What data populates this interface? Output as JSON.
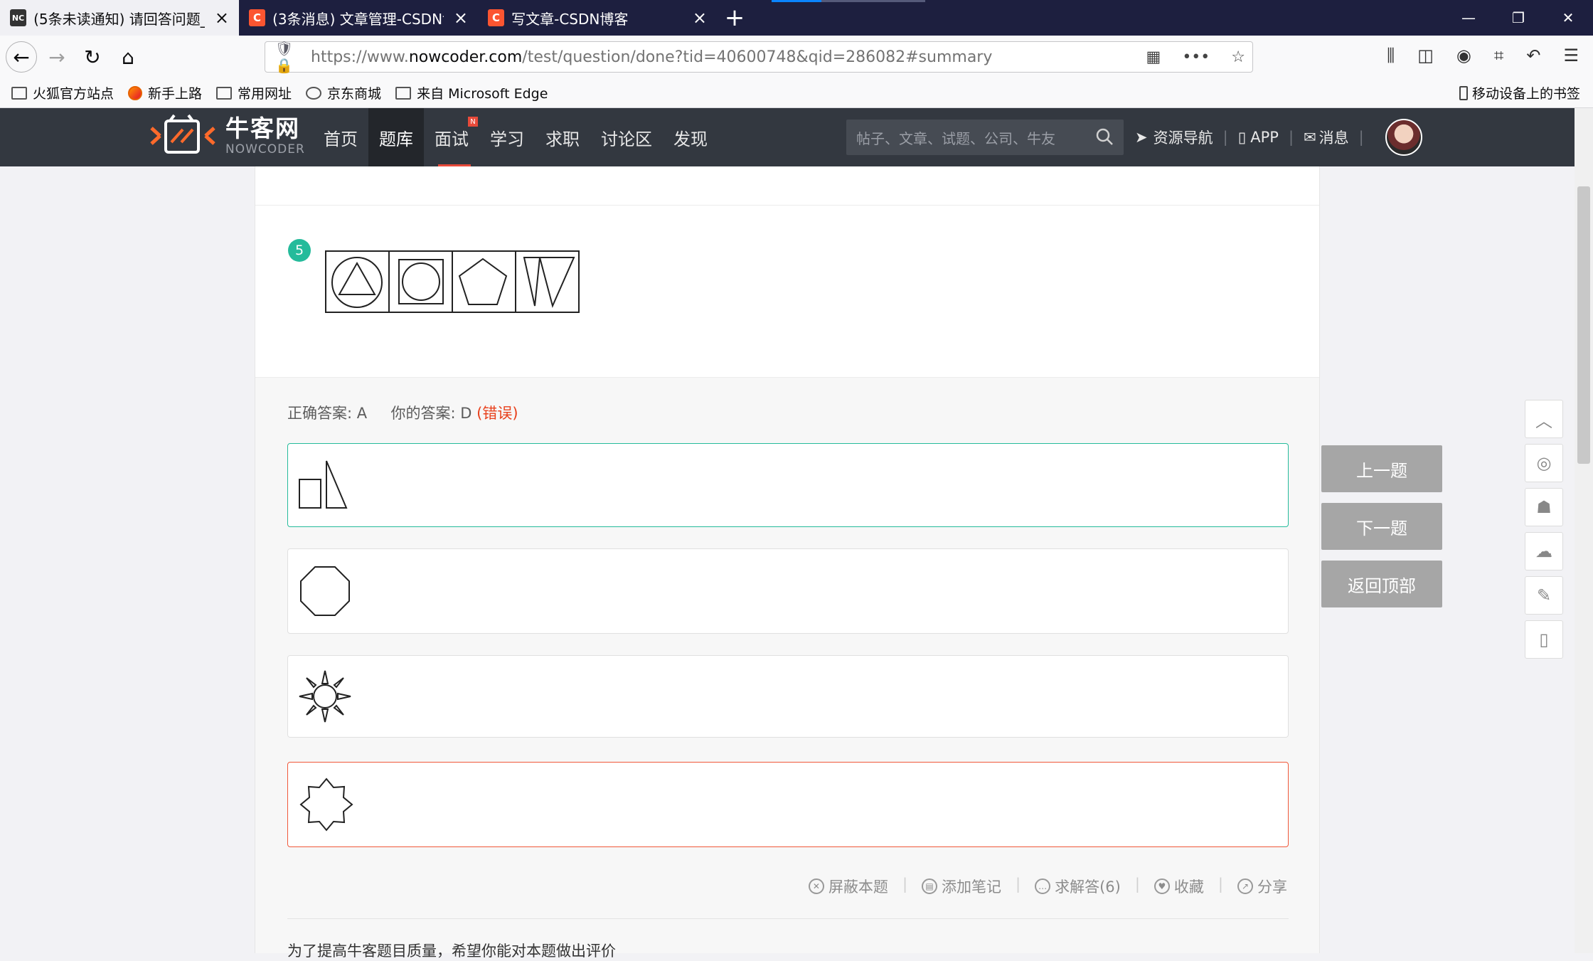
{
  "browser": {
    "tabs": [
      {
        "title": "(5条未读通知) 请回答问题_通用",
        "favicon": "nowcoder"
      },
      {
        "title": "(3条消息) 文章管理-CSDN博客",
        "favicon": "csdn"
      },
      {
        "title": "写文章-CSDN博客",
        "favicon": "csdn"
      }
    ],
    "new_tab": "+",
    "url_host": "https://www.",
    "url_domain": "nowcoder.com",
    "url_path": "/test/question/done?tid=40600748&qid=286082#summary",
    "bookmarks": [
      "火狐官方站点",
      "新手上路",
      "常用网址",
      "京东商城",
      "来自 Microsoft Edge"
    ],
    "bookmarks_right": "移动设备上的书签"
  },
  "site": {
    "logo_cn": "牛客网",
    "logo_en": "NOWCODER",
    "nav": [
      "首页",
      "题库",
      "面试",
      "学习",
      "求职",
      "讨论区",
      "发现"
    ],
    "nav_badge": "N",
    "search_placeholder": "帖子、文章、试题、公司、牛友",
    "resource_nav": "资源导航",
    "app": "APP",
    "messages": "消息"
  },
  "question": {
    "number": "5",
    "correct_label": "正确答案: A",
    "your_label": "你的答案: D",
    "wrong_tag": "(错误)",
    "options": [
      {
        "id": "A",
        "shape": "square-triangle",
        "state": "correct"
      },
      {
        "id": "B",
        "shape": "octagon",
        "state": "normal"
      },
      {
        "id": "C",
        "shape": "sun",
        "state": "normal"
      },
      {
        "id": "D",
        "shape": "eight-point-star",
        "state": "selected-wrong"
      }
    ],
    "actions": [
      "屏蔽本题",
      "添加笔记",
      "求解答(6)",
      "收藏",
      "分享"
    ],
    "rating_prompt": "为了提高牛客题目质量，希望你能对本题做出评价"
  },
  "side": {
    "prev": "上一题",
    "next": "下一题",
    "top": "返回顶部"
  },
  "colors": {
    "accent": "#25bb9b",
    "error": "#e8401c",
    "header_bg": "#333840"
  }
}
